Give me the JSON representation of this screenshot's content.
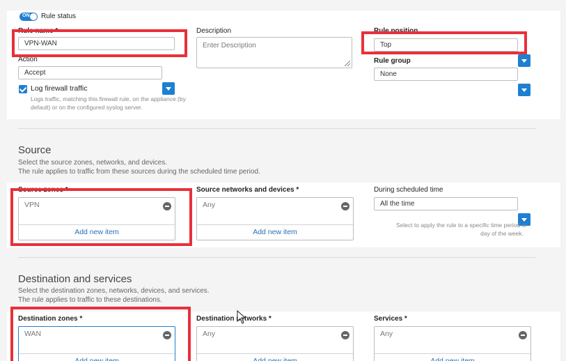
{
  "rule_status": {
    "toggle_text": "ON",
    "label": "Rule status"
  },
  "rule_name": {
    "label": "Rule name *",
    "value": "VPN-WAN"
  },
  "action": {
    "label": "Action",
    "value": "Accept"
  },
  "log_traffic": {
    "label": "Log firewall traffic",
    "help_line1": "Logs traffic, matching this firewall rule, on the appliance (by",
    "help_line2": "default) or on the configured syslog server."
  },
  "description": {
    "label": "Description",
    "placeholder": "Enter Description"
  },
  "rule_position": {
    "label": "Rule position",
    "value": "Top"
  },
  "rule_group": {
    "label": "Rule group",
    "value": "None"
  },
  "source": {
    "title": "Source",
    "desc_line1": "Select the source zones, networks, and devices.",
    "desc_line2": "The rule applies to traffic from these sources during the scheduled time period.",
    "zones": {
      "label": "Source zones *",
      "item": "VPN",
      "add": "Add new item"
    },
    "networks": {
      "label": "Source networks and devices *",
      "item": "Any",
      "add": "Add new item"
    },
    "schedule": {
      "label": "During scheduled time",
      "value": "All the time",
      "help_line1": "Select to apply the rule to a specific time period or",
      "help_line2": "day of the week."
    }
  },
  "destination": {
    "title": "Destination and services",
    "desc_line1": "Select the destination zones, networks, devices, and services.",
    "desc_line2": "The rule applies to traffic to these destinations.",
    "zones": {
      "label": "Destination zones *",
      "item": "WAN",
      "add": "Add new item"
    },
    "networks": {
      "label": "Destination networks *",
      "item": "Any",
      "add": "Add new item"
    },
    "services": {
      "label": "Services *",
      "item": "Any",
      "add": "Add new item"
    }
  },
  "colors": {
    "accent": "#1f7fd0",
    "highlight": "#e8303a",
    "link": "#2a6fb5"
  }
}
